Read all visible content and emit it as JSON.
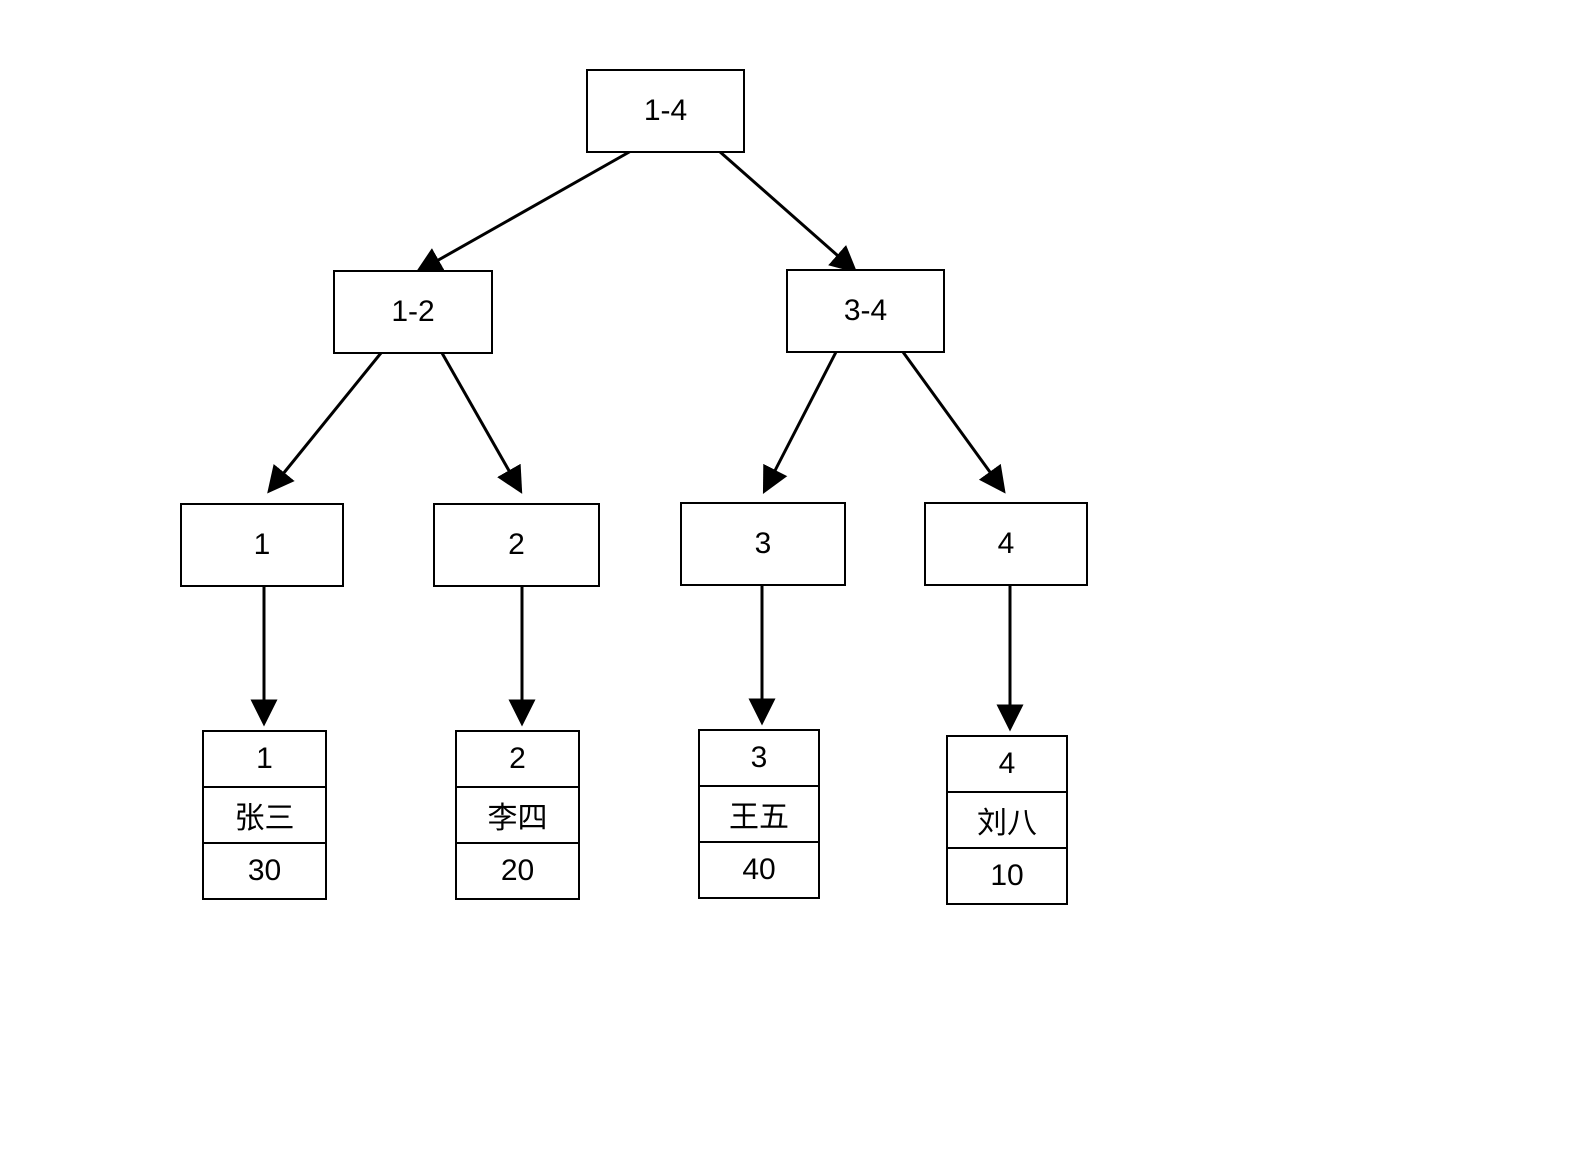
{
  "tree": {
    "root": {
      "label": "1-4"
    },
    "level2": {
      "left": {
        "label": "1-2"
      },
      "right": {
        "label": "3-4"
      }
    },
    "level3": {
      "n1": {
        "label": "1"
      },
      "n2": {
        "label": "2"
      },
      "n3": {
        "label": "3"
      },
      "n4": {
        "label": "4"
      }
    },
    "leaves": {
      "l1": {
        "id": "1",
        "name": "张三",
        "value": "30"
      },
      "l2": {
        "id": "2",
        "name": "李四",
        "value": "20"
      },
      "l3": {
        "id": "3",
        "name": "王五",
        "value": "40"
      },
      "l4": {
        "id": "4",
        "name": "刘八",
        "value": "10"
      }
    }
  }
}
